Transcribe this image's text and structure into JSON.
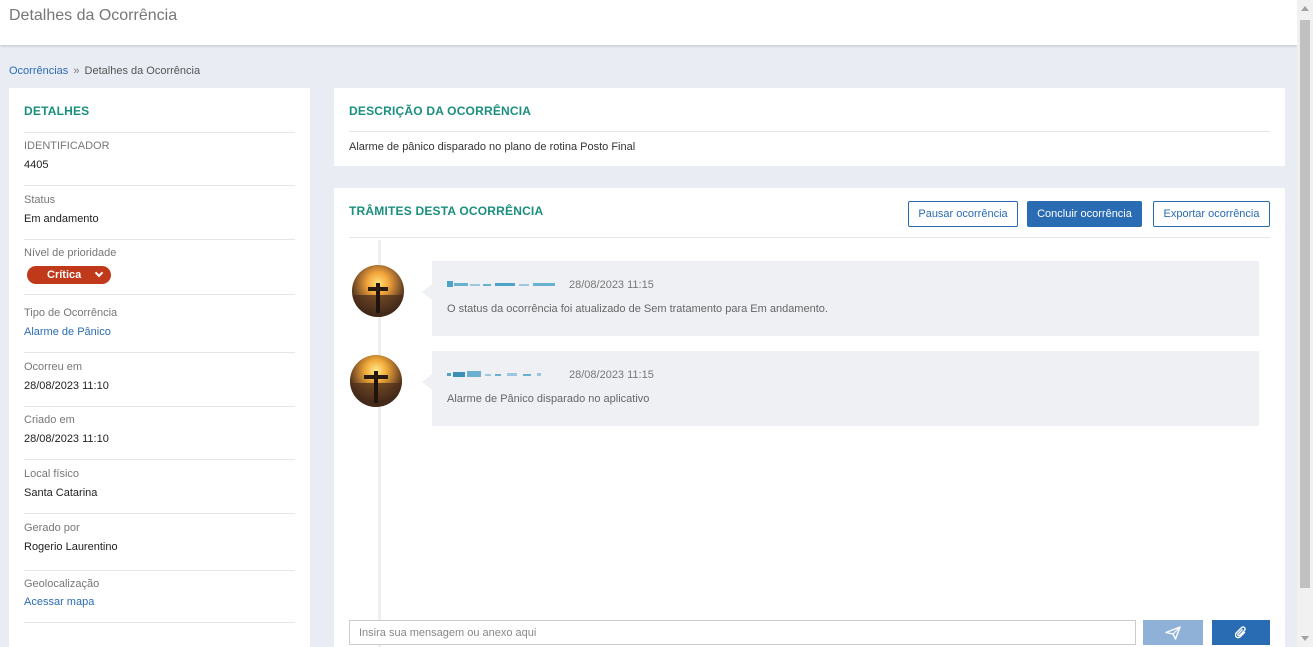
{
  "header": {
    "title": "Detalhes da Ocorrência"
  },
  "breadcrumb": {
    "link": "Ocorrências",
    "separator": "»",
    "current": "Detalhes da Ocorrência"
  },
  "details": {
    "title": "DETALHES",
    "identificador_label": "IDENTIFICADOR",
    "identificador_value": "4405",
    "status_label": "Status",
    "status_value": "Em andamento",
    "prioridade_label": "Nível de prioridade",
    "prioridade_value": "Crítica",
    "tipo_label": "Tipo de Ocorrência",
    "tipo_value": "Alarme de Pânico",
    "ocorreu_label": "Ocorreu em",
    "ocorreu_value": "28/08/2023 11:10",
    "criado_label": "Criado em",
    "criado_value": "28/08/2023 11:10",
    "local_label": "Local físico",
    "local_value": "Santa Catarina",
    "gerado_label": "Gerado por",
    "gerado_value": "Rogerio Laurentino",
    "geo_label": "Geolocalização",
    "geo_link": "Acessar mapa"
  },
  "description": {
    "title": "DESCRIÇÃO DA OCORRÊNCIA",
    "text": "Alarme de pânico disparado no plano de rotina Posto Final"
  },
  "tramites": {
    "title": "TRÂMITES DESTA OCORRÊNCIA",
    "pause_label": "Pausar ocorrência",
    "conclude_label": "Concluir ocorrência",
    "export_label": "Exportar ocorrência",
    "messages": [
      {
        "time": "28/08/2023 11:15",
        "text": "O status da ocorrência foi atualizado de Sem tratamento para Em andamento."
      },
      {
        "time": "28/08/2023 11:15",
        "text": "Alarme de Pânico disparado no aplicativo"
      }
    ],
    "input_placeholder": "Insira sua mensagem ou anexo aqui"
  },
  "colors": {
    "accent_teal": "#1a8f7d",
    "primary_blue": "#2a6cb3",
    "priority_red": "#c0391b",
    "page_bg": "#e9ecf3"
  },
  "icons": {
    "send": "paper-plane-icon",
    "attach": "paperclip-icon",
    "priority_dropdown": "chevron-down-icon"
  }
}
